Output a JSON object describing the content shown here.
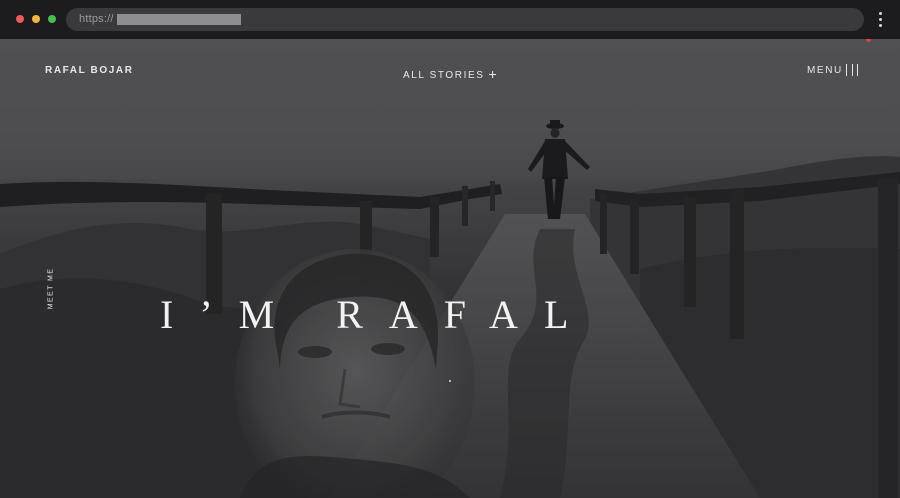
{
  "browser": {
    "url_scheme": "https://",
    "icons": [
      "close-dot",
      "minimize-dot",
      "maximize-dot",
      "kebab-menu-icon"
    ]
  },
  "nav": {
    "brand": "RAFAL BOJAR",
    "stories": "ALL STORIES",
    "stories_icon": "+",
    "menu": "MENU"
  },
  "hero": {
    "side_label": "MEET ME",
    "headline": "I’M RAFAL"
  },
  "colors": {
    "chrome_bg": "#1c1b1d",
    "urlbar_bg": "#3a393c",
    "text_light": "#f2f2f2",
    "record_dot": "#e0443e"
  }
}
